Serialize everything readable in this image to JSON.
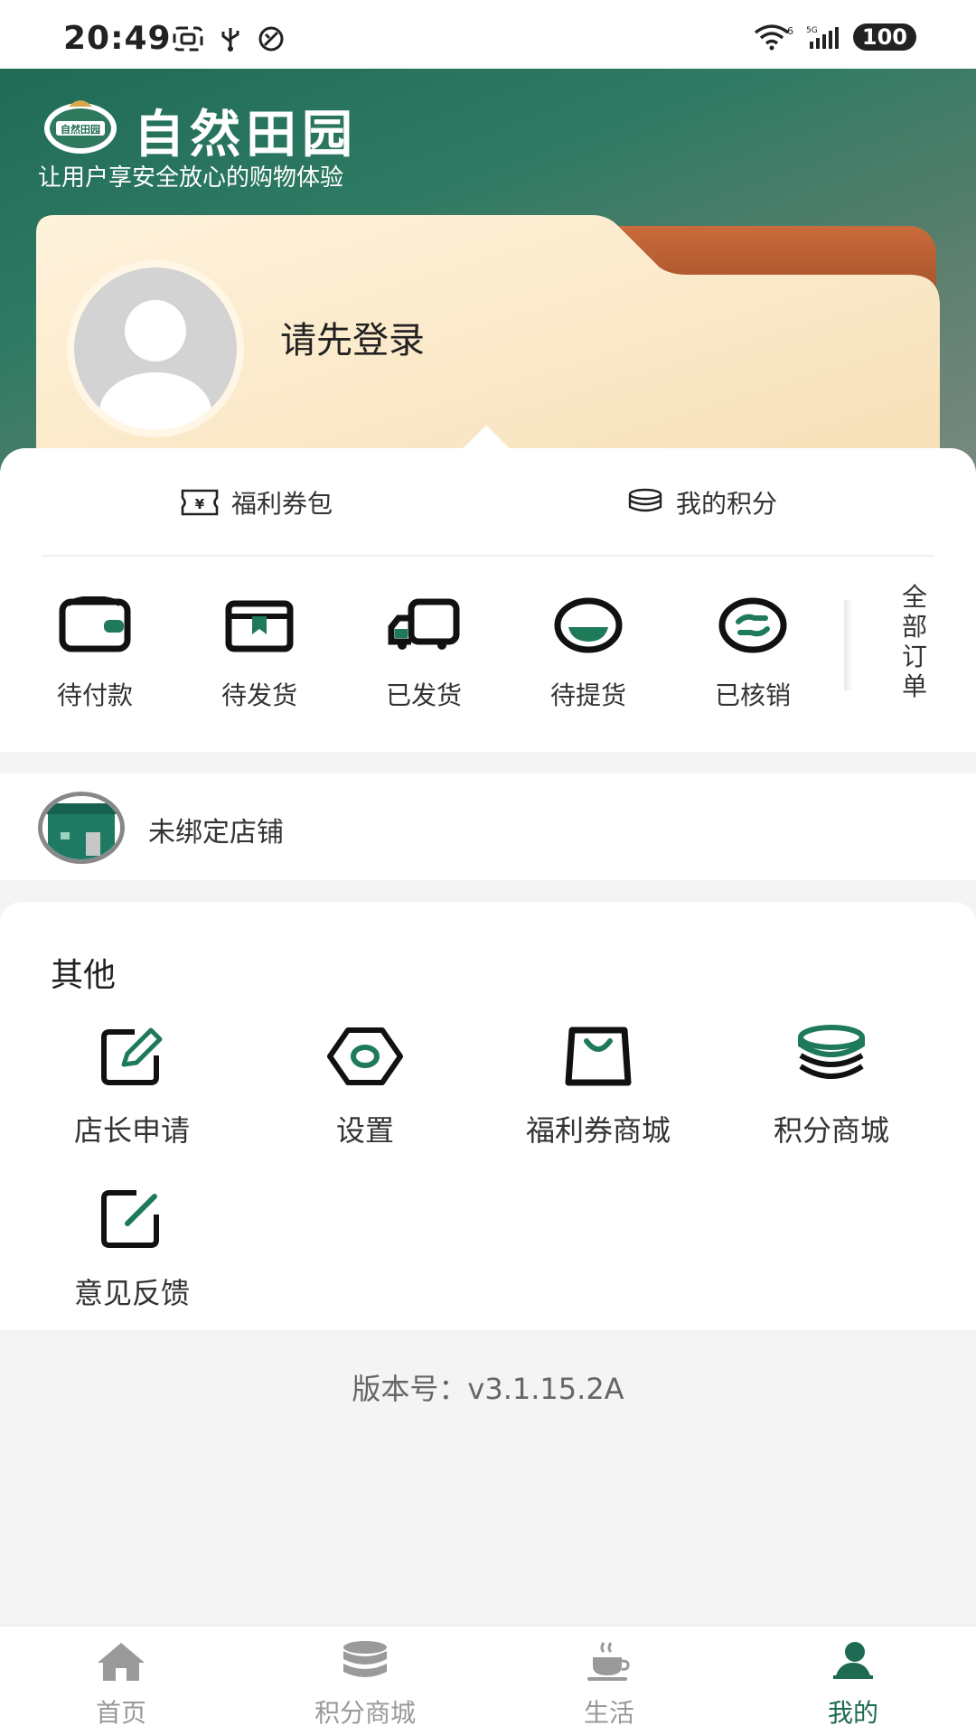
{
  "status_bar": {
    "time": "20:49",
    "battery": "100",
    "net_badge_1": "6",
    "net_badge_2": "5G"
  },
  "header": {
    "logo_badge_text": "自然田园",
    "brand_name": "自然田园",
    "slogan": "让用户享安全放心的购物体验"
  },
  "user_card": {
    "login_prompt": "请先登录"
  },
  "quick_tabs": [
    {
      "label": "福利券包",
      "icon": "coupon-icon"
    },
    {
      "label": "我的积分",
      "icon": "coins-icon"
    }
  ],
  "orders": {
    "items": [
      {
        "label": "待付款",
        "icon": "wallet-icon"
      },
      {
        "label": "待发货",
        "icon": "box-icon"
      },
      {
        "label": "已发货",
        "icon": "truck-icon"
      },
      {
        "label": "待提货",
        "icon": "pickup-icon"
      },
      {
        "label": "已核销",
        "icon": "verified-icon"
      }
    ],
    "all_orders": "全部订单"
  },
  "store": {
    "text": "未绑定店铺"
  },
  "others": {
    "title": "其他",
    "items": [
      {
        "label": "店长申请",
        "icon": "edit-icon"
      },
      {
        "label": "设置",
        "icon": "settings-icon"
      },
      {
        "label": "福利券商城",
        "icon": "shopping-bag-icon"
      },
      {
        "label": "积分商城",
        "icon": "coins-icon"
      },
      {
        "label": "意见反馈",
        "icon": "feedback-icon"
      }
    ]
  },
  "version": "版本号：v3.1.15.2A",
  "bottom_nav": [
    {
      "label": "首页",
      "icon": "home-icon",
      "active": false
    },
    {
      "label": "积分商城",
      "icon": "database-icon",
      "active": false
    },
    {
      "label": "生活",
      "icon": "coffee-icon",
      "active": false
    },
    {
      "label": "我的",
      "icon": "user-icon",
      "active": true
    }
  ],
  "colors": {
    "brand_green": "#1e6a52",
    "header_dark": "#1f6b56",
    "card_beige": "#fbe9c8",
    "card_back_brown": "#a24a22"
  }
}
